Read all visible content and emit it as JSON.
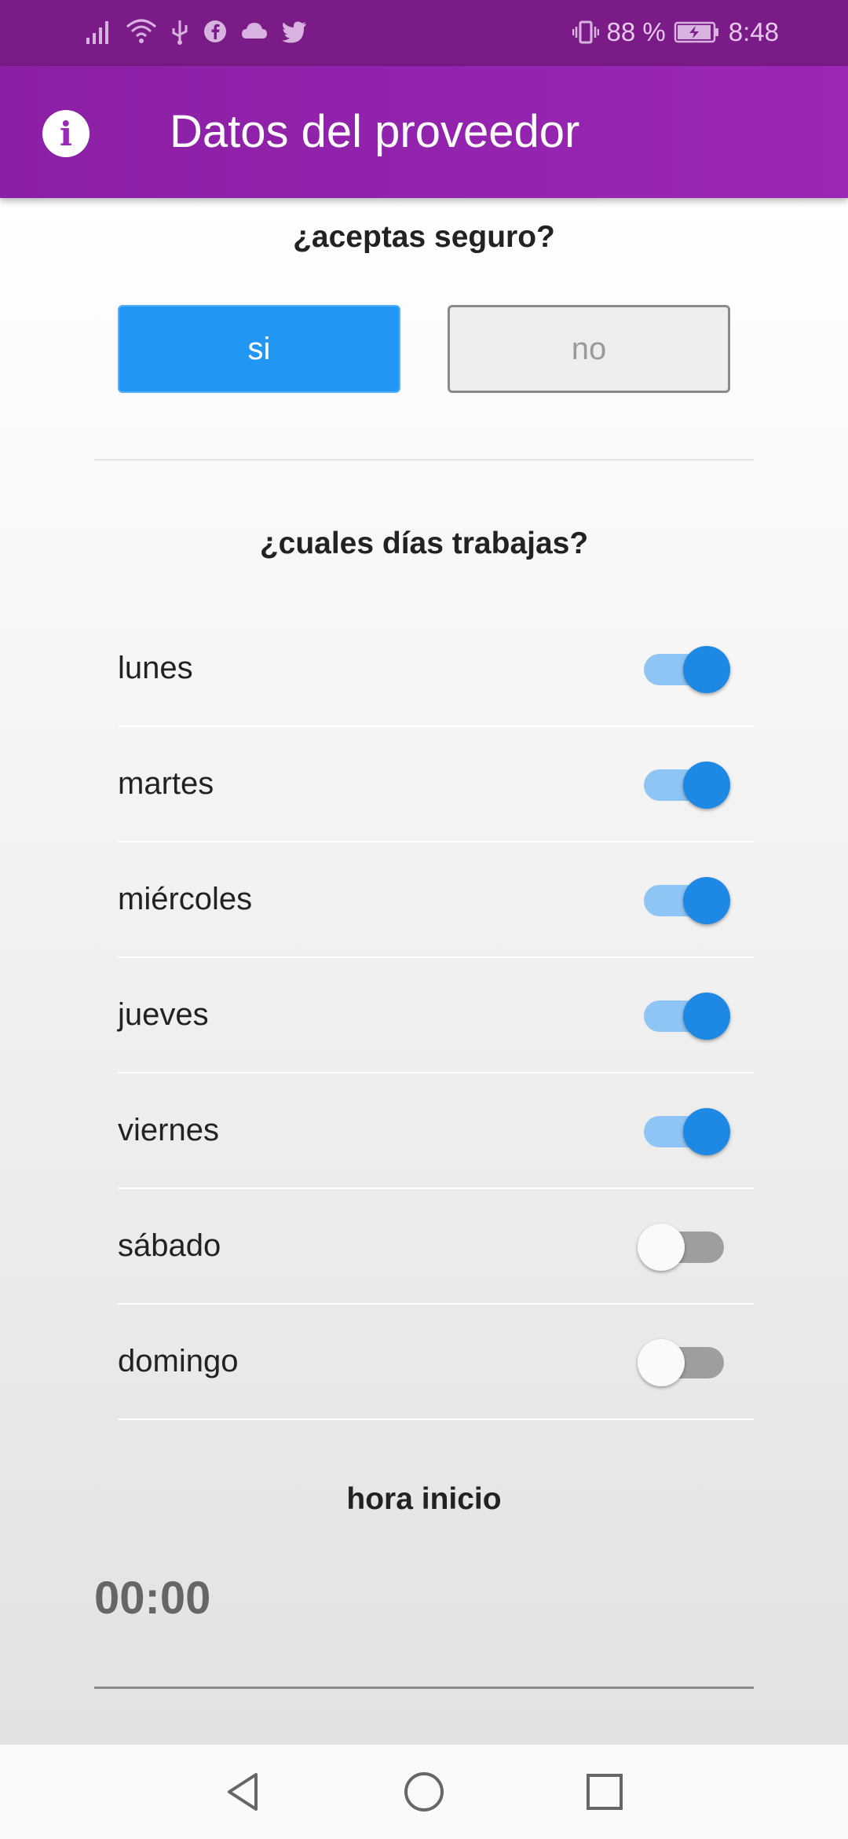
{
  "status_bar": {
    "battery": "88 %",
    "time": "8:48",
    "icons": [
      "signal-icon",
      "wifi-icon",
      "usb-icon",
      "facebook-icon",
      "cloud-icon",
      "twitter-icon",
      "vibrate-icon",
      "battery-icon"
    ]
  },
  "app_bar": {
    "title": "Datos del proveedor",
    "icon": "info-icon"
  },
  "insurance": {
    "question": "¿aceptas seguro?",
    "yes_label": "si",
    "no_label": "no",
    "selected": "si"
  },
  "workdays": {
    "question": "¿cuales días trabajas?",
    "days": [
      {
        "label": "lunes",
        "enabled": true
      },
      {
        "label": "martes",
        "enabled": true
      },
      {
        "label": "miércoles",
        "enabled": true
      },
      {
        "label": "jueves",
        "enabled": true
      },
      {
        "label": "viernes",
        "enabled": true
      },
      {
        "label": "sábado",
        "enabled": false
      },
      {
        "label": "domingo",
        "enabled": false
      }
    ]
  },
  "start_time": {
    "label": "hora inicio",
    "value": "00:00"
  },
  "colors": {
    "status_bar": "#7a1b87",
    "app_bar": "#9a27b5",
    "accent": "#2196f3",
    "switch_on": "#1e88e5"
  },
  "nav_bar": {
    "buttons": [
      "back-icon",
      "home-icon",
      "recents-icon"
    ]
  }
}
